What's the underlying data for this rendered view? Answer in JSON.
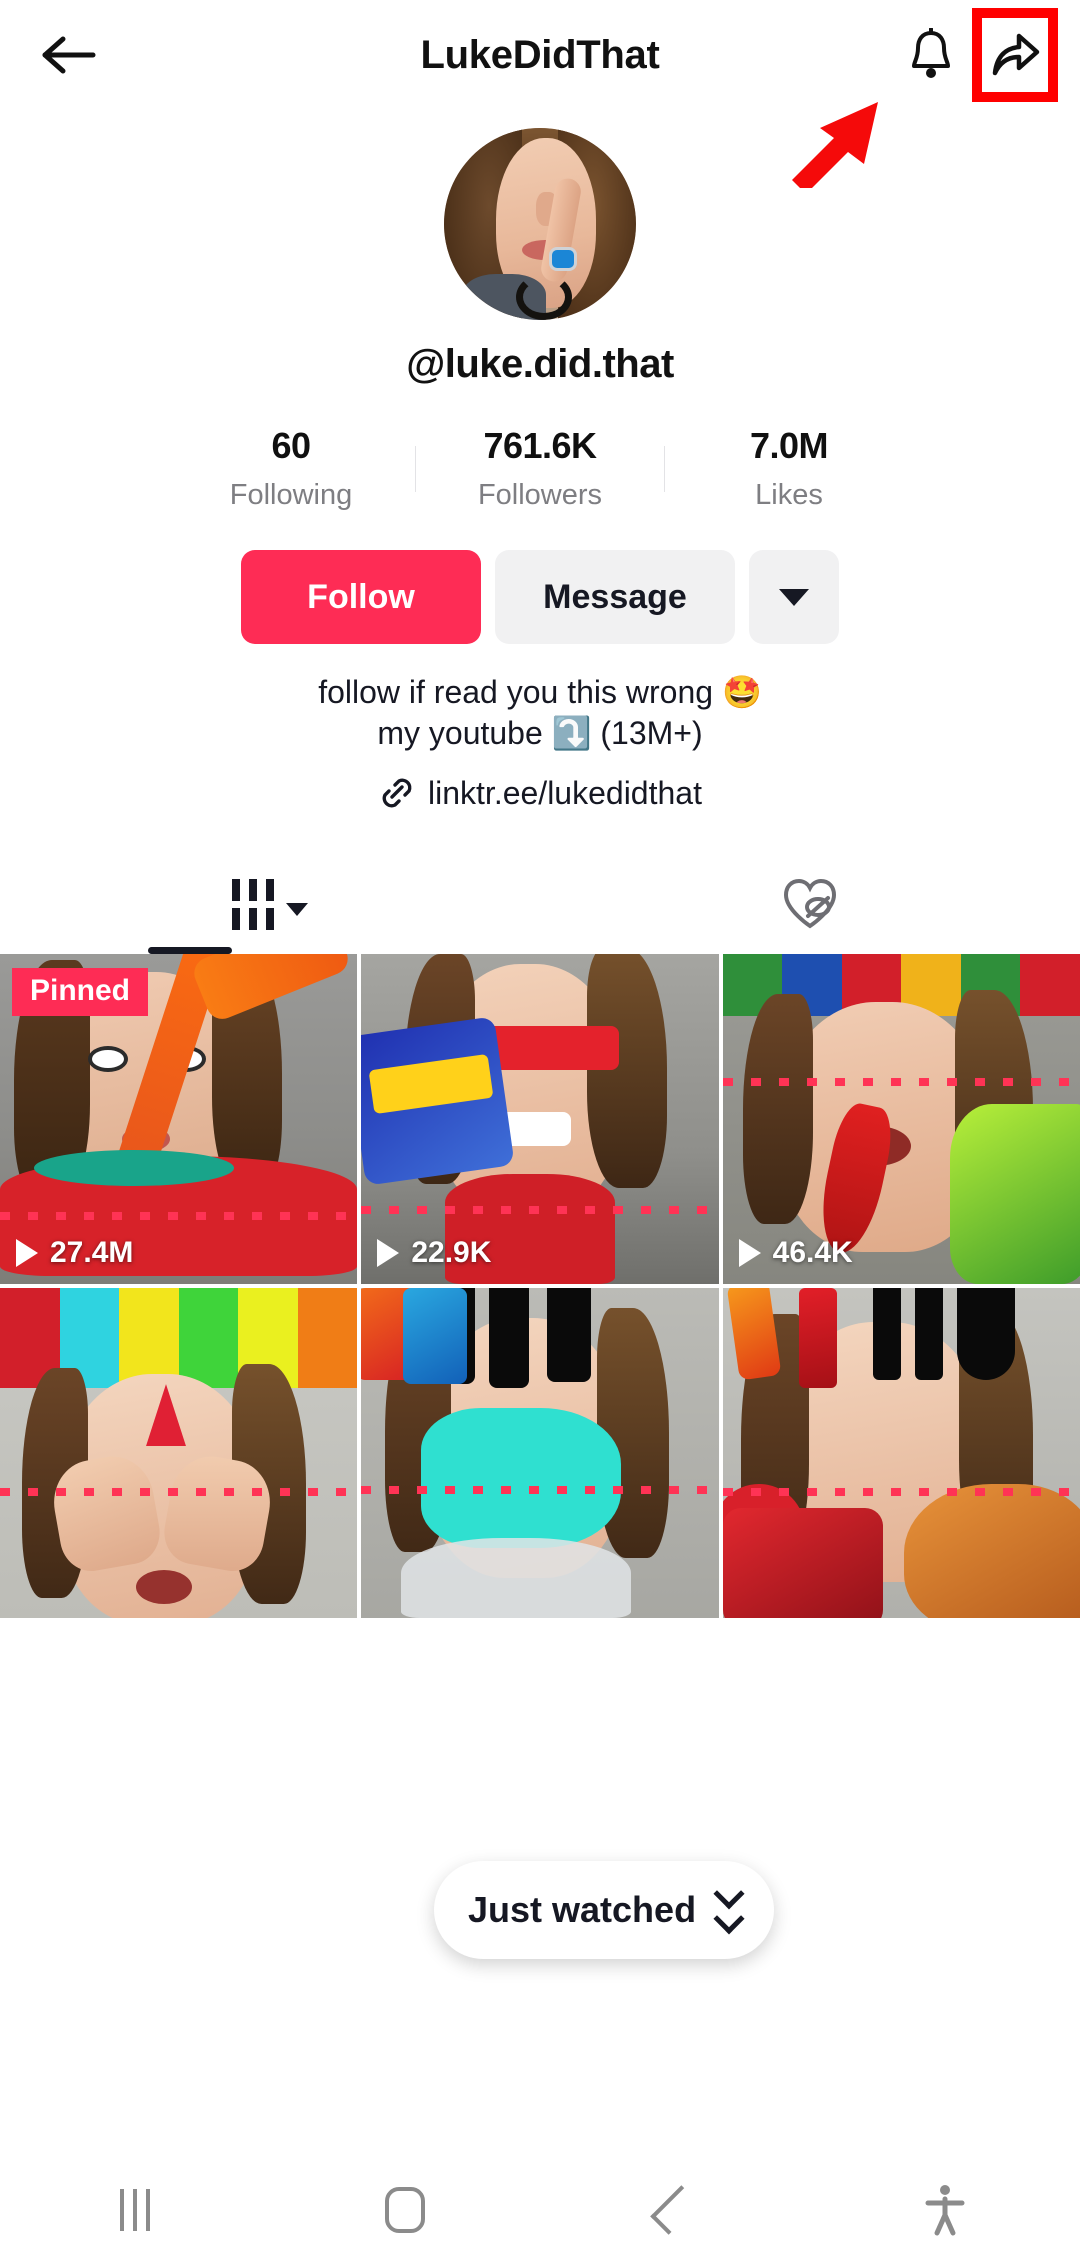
{
  "header": {
    "back_icon": "arrow-left-icon",
    "title": "LukeDidThat",
    "bell_icon": "bell-icon",
    "share_icon": "share-arrow-icon",
    "highlight_color": "#ff0000"
  },
  "profile": {
    "avatar_alt": "profile-photo",
    "handle": "@luke.did.that"
  },
  "stats": [
    {
      "value": "60",
      "label": "Following"
    },
    {
      "value": "761.6K",
      "label": "Followers"
    },
    {
      "value": "7.0M",
      "label": "Likes"
    }
  ],
  "actions": {
    "follow_label": "Follow",
    "follow_color": "#fe2c55",
    "message_label": "Message",
    "more_icon": "chevron-down-icon"
  },
  "bio": {
    "line1": "follow if read you this wrong 🤩",
    "line2": "my youtube ⤵️ (13M+)",
    "link_icon": "link-icon",
    "link_text": "linktr.ee/lukedidthat"
  },
  "tabs": [
    {
      "name": "videos-tab",
      "icon": "grid-icon",
      "caret": "chevron-down-icon",
      "active": true
    },
    {
      "name": "liked-tab",
      "icon": "heart-hidden-icon",
      "active": false
    }
  ],
  "videos": [
    {
      "views": "27.4M",
      "pinned_label": "Pinned",
      "pinned": true
    },
    {
      "views": "22.9K",
      "pinned": false
    },
    {
      "views": "46.4K",
      "pinned": false
    },
    {
      "views": "",
      "pinned": false
    },
    {
      "views": "",
      "pinned": false
    },
    {
      "views": "",
      "pinned": false
    }
  ],
  "toast": {
    "label": "Just watched",
    "icon": "double-chevron-down-icon"
  },
  "navbar": [
    {
      "name": "recents-button",
      "icon": "recents-icon"
    },
    {
      "name": "home-button",
      "icon": "home-icon"
    },
    {
      "name": "back-button",
      "icon": "chevron-left-icon"
    },
    {
      "name": "accessibility-button",
      "icon": "accessibility-person-icon"
    }
  ]
}
